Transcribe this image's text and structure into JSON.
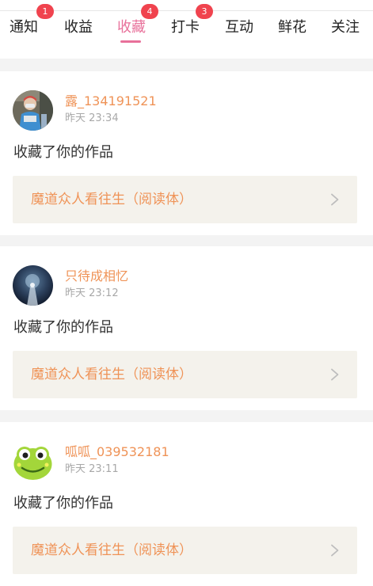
{
  "tabs": [
    {
      "label": "通知",
      "badge": "1",
      "active": false
    },
    {
      "label": "收益",
      "badge": "",
      "active": false
    },
    {
      "label": "收藏",
      "badge": "4",
      "active": true
    },
    {
      "label": "打卡",
      "badge": "3",
      "active": false
    },
    {
      "label": "互动",
      "badge": "",
      "active": false
    },
    {
      "label": "鲜花",
      "badge": "",
      "active": false
    },
    {
      "label": "关注",
      "badge": "",
      "active": false
    }
  ],
  "feed": [
    {
      "username": "露_134191521",
      "time": "昨天 23:34",
      "action": "收藏了你的作品",
      "work_title": "魔道众人看往生（阅读体）"
    },
    {
      "username": "只待成相忆",
      "time": "昨天 23:12",
      "action": "收藏了你的作品",
      "work_title": "魔道众人看往生（阅读体）"
    },
    {
      "username": "呱呱_039532181",
      "time": "昨天 23:11",
      "action": "收藏了你的作品",
      "work_title": "魔道众人看往生（阅读体）"
    }
  ],
  "colors": {
    "accent_pink": "#e8709a",
    "username_orange": "#ef9357",
    "badge_red": "#f0434e",
    "link_bg": "#f4f2ec",
    "page_bg": "#f3f3f3"
  }
}
